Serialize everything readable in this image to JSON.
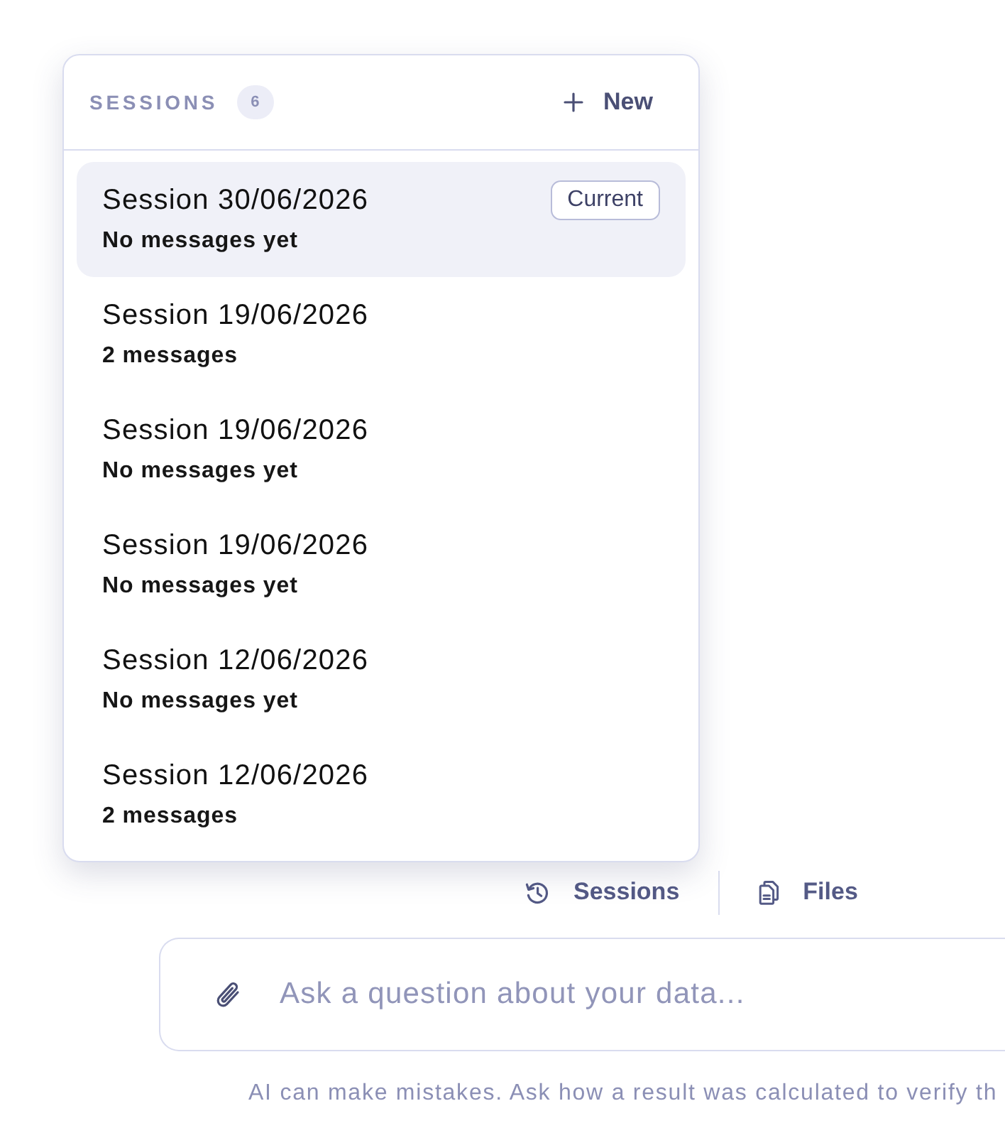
{
  "sessions_panel": {
    "title": "SESSIONS",
    "count": "6",
    "new_button": {
      "label": "New"
    },
    "items": [
      {
        "title": "Session 30/06/2026",
        "subtitle": "No messages yet",
        "selected": true,
        "badge": "Current"
      },
      {
        "title": "Session 19/06/2026",
        "subtitle": "2 messages",
        "selected": false
      },
      {
        "title": "Session 19/06/2026",
        "subtitle": "No messages yet",
        "selected": false
      },
      {
        "title": "Session 19/06/2026",
        "subtitle": "No messages yet",
        "selected": false
      },
      {
        "title": "Session 12/06/2026",
        "subtitle": "No messages yet",
        "selected": false
      },
      {
        "title": "Session 12/06/2026",
        "subtitle": "2 messages",
        "selected": false
      }
    ]
  },
  "toolbar": {
    "buttons": [
      {
        "kind": "history",
        "label": "Sessions"
      },
      {
        "kind": "files",
        "label": "Files"
      }
    ]
  },
  "composer": {
    "placeholder": "Ask a question about your data..."
  },
  "disclaimer": "AI can make mistakes. Ask how a result was calculated to verify th"
}
